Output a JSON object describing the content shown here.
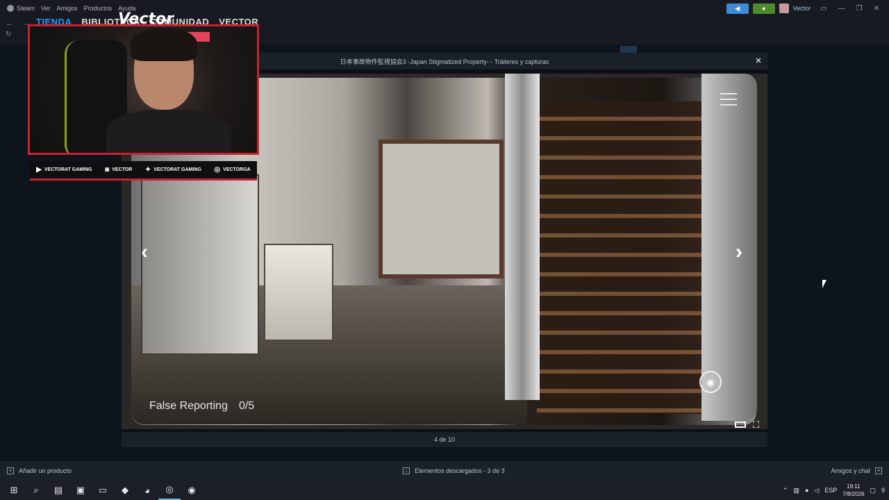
{
  "steam_menu": [
    "Steam",
    "Ver",
    "Amigos",
    "Productos",
    "Ayuda"
  ],
  "user": {
    "name": "Vector"
  },
  "nav_tabs": [
    {
      "label": "TIENDA"
    },
    {
      "label": "BIBLIOTECA"
    },
    {
      "label": "COMUNIDAD"
    },
    {
      "label": "VECTOR"
    }
  ],
  "modal": {
    "title": "日本事故物件監視協会3 -Japan Stigmatized Property- - Tráileres y capturas",
    "close_glyph": "×",
    "counter": "4 de 10"
  },
  "game_hud": {
    "label": "False Reporting",
    "progress": "0/5"
  },
  "overlay": {
    "brand": "Vector",
    "socials": [
      {
        "icon": "youtube-icon",
        "glyph": "▶",
        "text": "VECTORAT GAMING"
      },
      {
        "icon": "twitch-icon",
        "glyph": "◙",
        "text": "VECTOR"
      },
      {
        "icon": "twitter-icon",
        "glyph": "✦",
        "text": "VECTORAT GAMING"
      },
      {
        "icon": "instagram-icon",
        "glyph": "◎",
        "text": "VECTORGA"
      }
    ]
  },
  "bottombar": {
    "add_product": "Añadir un producto",
    "downloads": "Elementos descargados - 3 de 3",
    "friends": "Amigos y chat"
  },
  "taskbar": {
    "language": "ESP",
    "time": "19:11",
    "date": "7/8/2026",
    "notification_count": "9"
  },
  "colors": {
    "accent": "#1a9fff",
    "overlay_red": "#c82232"
  }
}
